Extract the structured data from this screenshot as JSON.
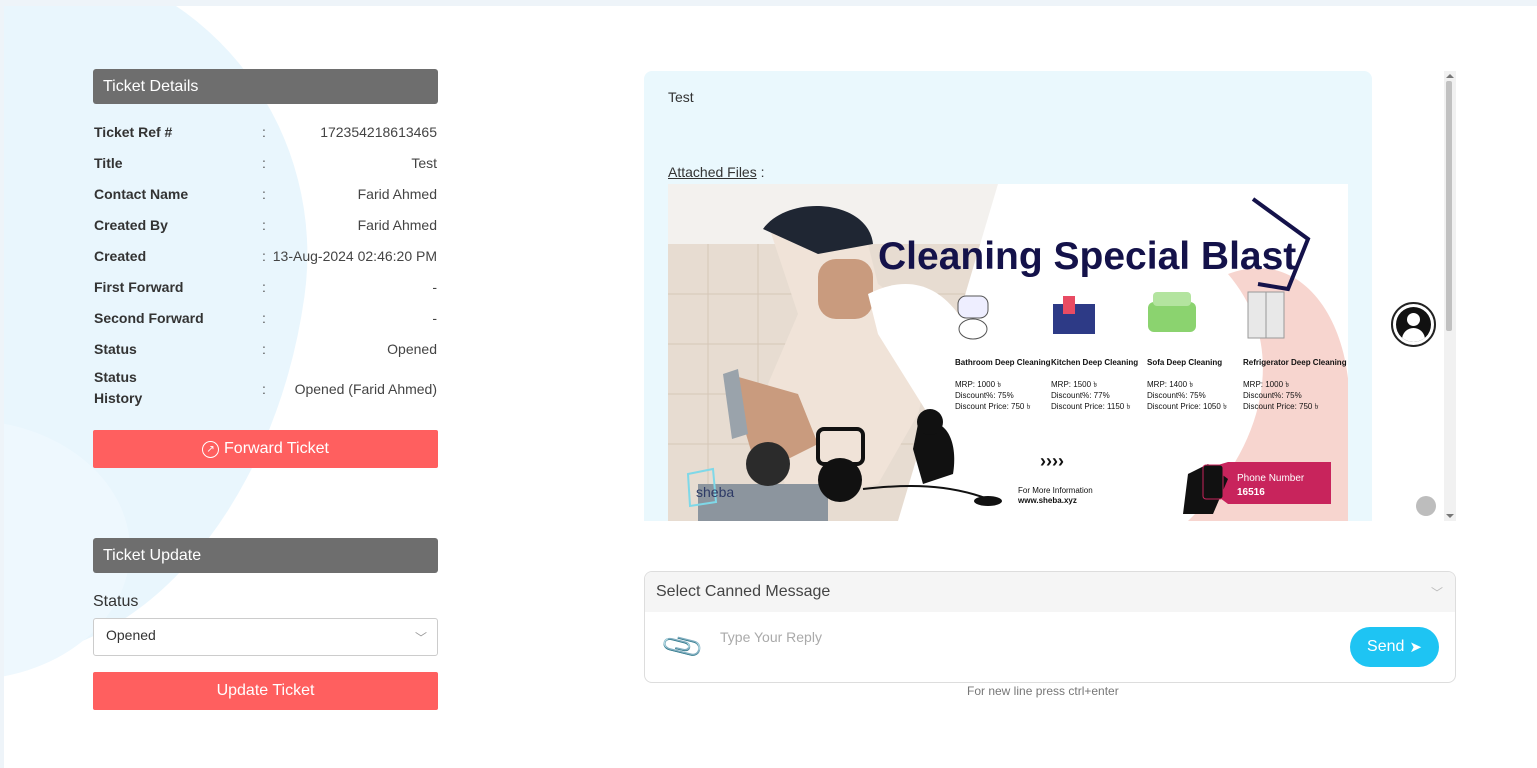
{
  "ticket_details": {
    "header": "Ticket Details",
    "rows": [
      {
        "label": "Ticket Ref #",
        "colon": ":",
        "value": "172354218613465"
      },
      {
        "label": "Title",
        "colon": ":",
        "value": "Test"
      },
      {
        "label": "Contact Name",
        "colon": ":",
        "value": "Farid Ahmed"
      },
      {
        "label": "Created By",
        "colon": ":",
        "value": "Farid Ahmed"
      },
      {
        "label": "Created",
        "colon": ":",
        "value": "13-Aug-2024 02:46:20 PM"
      },
      {
        "label": "First Forward",
        "colon": ":",
        "value": "-"
      },
      {
        "label": "Second Forward",
        "colon": ":",
        "value": "-"
      },
      {
        "label": "Status",
        "colon": ":",
        "value": "Opened"
      },
      {
        "label": "Status History",
        "colon": ":",
        "value": "Opened (Farid Ahmed)"
      }
    ],
    "forward_button": "Forward Ticket"
  },
  "ticket_update": {
    "header": "Ticket Update",
    "status_label": "Status",
    "status_value": "Opened",
    "update_button": "Update Ticket"
  },
  "message": {
    "text": "Test",
    "attached_label": "Attached Files",
    "attached_suffix": " :",
    "image_alt": {
      "title": "Cleaning Special Blast",
      "items": [
        {
          "name": "Bathroom Deep Cleaning",
          "mrp": "MRP: 1000 ৳",
          "discount": "Discount%: 75%",
          "price": "Discount Price: 750 ৳"
        },
        {
          "name": "Kitchen Deep Cleaning",
          "mrp": "MRP: 1500 ৳",
          "discount": "Discount%: 77%",
          "price": "Discount Price: 1150 ৳"
        },
        {
          "name": "Sofa Deep Cleaning",
          "mrp": "MRP: 1400 ৳",
          "discount": "Discount%: 75%",
          "price": "Discount Price: 1050 ৳"
        },
        {
          "name": "Refrigerator Deep Cleaning",
          "mrp": "MRP: 1000 ৳",
          "discount": "Discount%: 75%",
          "price": "Discount Price: 750 ৳"
        }
      ],
      "arrows": "››››",
      "more_info": "For More Information",
      "website": "www.sheba.xyz",
      "phone_label": "Phone Number",
      "phone_number": "16516",
      "brand": "sheba"
    }
  },
  "reply": {
    "canned_placeholder": "Select Canned Message",
    "reply_placeholder": "Type Your Reply",
    "send_label": "Send",
    "hint": "For new line press ctrl+enter"
  },
  "colors": {
    "header_bg": "#6e6e6e",
    "red_button": "#ff5f5f",
    "send_button": "#1ec4f3",
    "message_bg": "#eaf8fd",
    "poster_navy": "#14124a",
    "poster_pink": "#c8245c"
  },
  "icons": [
    "forward-arrow-icon",
    "chevron-down-icon",
    "paperclip-icon",
    "send-plane-icon",
    "user-avatar-icon"
  ]
}
